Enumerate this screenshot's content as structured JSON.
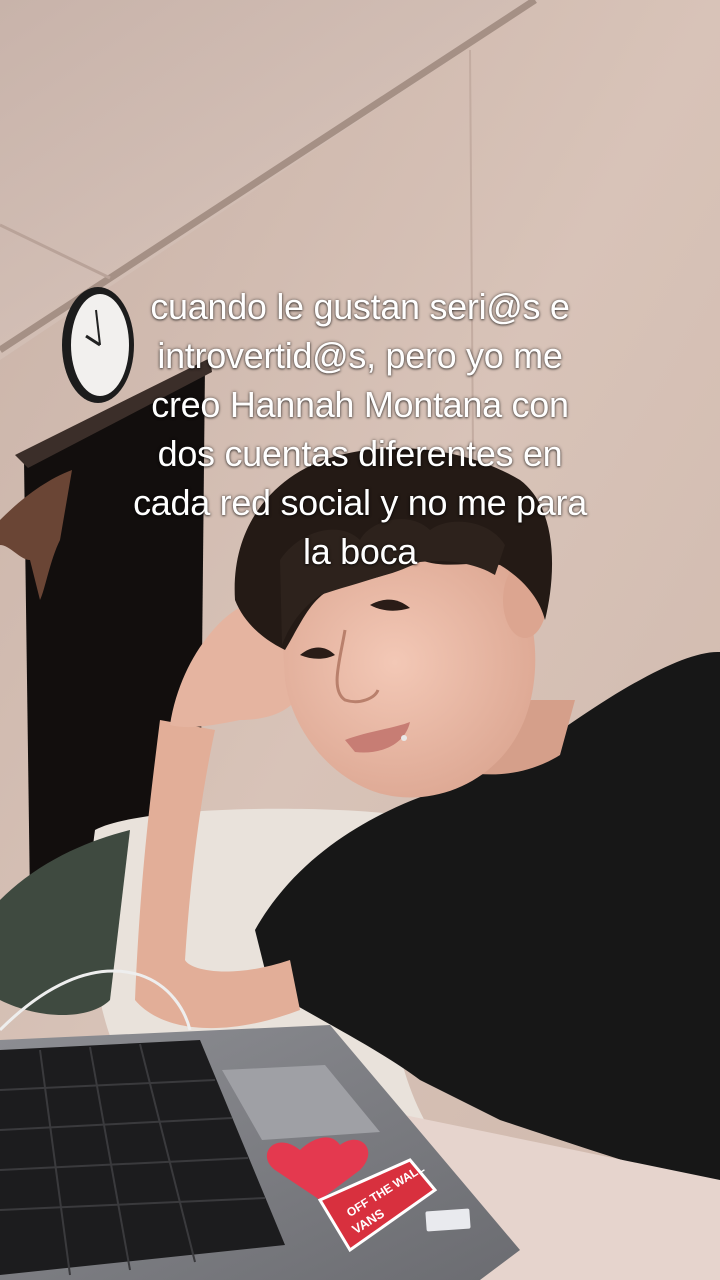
{
  "caption": {
    "line1": "cuando le gustan seri@s e",
    "line2": "introvertid@s, pero yo me",
    "line3": "creo Hannah Montana con",
    "line4": "dos cuentas diferentes en",
    "line5": "cada red social y no me para",
    "line6": "la boca"
  },
  "sticker": {
    "text": "OFF THE WALL",
    "brand": "VANS"
  },
  "colors": {
    "wall": "#d9c3b8",
    "shirt": "#161616",
    "hair": "#241a15",
    "sticker_red": "#e4394f"
  }
}
